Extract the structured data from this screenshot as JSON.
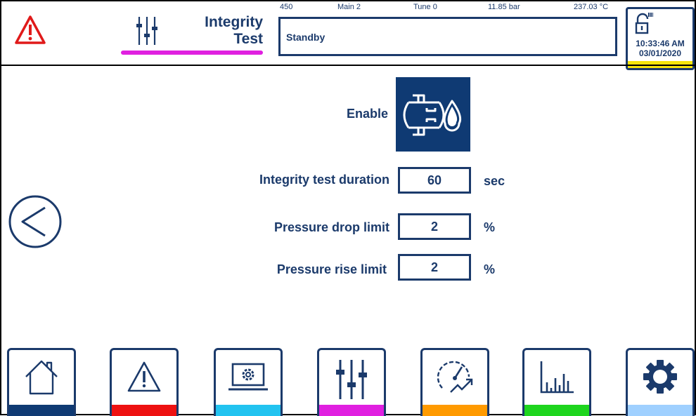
{
  "header": {
    "title_line1": "Integrity",
    "title_line2": "Test",
    "title_accent": "#e020e0"
  },
  "status": {
    "field1": "450",
    "field2": "Main 2",
    "field3": "Tune 0",
    "field4": "11.85  bar",
    "field5": "237.03 °C",
    "message": "Standby"
  },
  "clock": {
    "time": "10:33:46 AM",
    "date": "03/01/2020",
    "stripe_color": "#f5e50a"
  },
  "form": {
    "enable_label": "Enable",
    "duration_label": "Integrity test duration",
    "duration_value": "60",
    "duration_unit": "sec",
    "drop_label": "Pressure drop limit",
    "drop_value": "2",
    "drop_unit": "%",
    "rise_label": "Pressure rise limit",
    "rise_value": "2",
    "rise_unit": "%"
  },
  "nav": [
    {
      "icon": "home-icon",
      "color": "#0f3a73"
    },
    {
      "icon": "alarm-icon",
      "color": "#ee1111"
    },
    {
      "icon": "monitor-settings-icon",
      "color": "#22c3f0"
    },
    {
      "icon": "sliders-icon",
      "color": "#e020e0"
    },
    {
      "icon": "gauge-trend-icon",
      "color": "#ff9a00"
    },
    {
      "icon": "bar-chart-icon",
      "color": "#1ed51e"
    },
    {
      "icon": "gear-icon",
      "color": "#9fd0ff"
    }
  ]
}
